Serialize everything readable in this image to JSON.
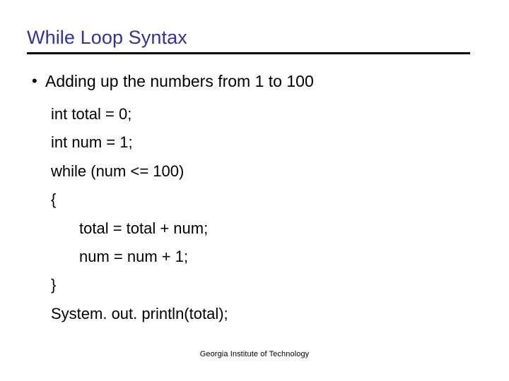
{
  "slide": {
    "title": "While Loop Syntax",
    "title_color": "#333399",
    "rule_color": "#000000",
    "background_color": "#ffffff",
    "bullet": {
      "marker": "•",
      "text": "Adding up the numbers from 1 to 100"
    },
    "code_lines": [
      {
        "text": "int total = 0;",
        "indent": 0
      },
      {
        "text": "int num = 1;",
        "indent": 0
      },
      {
        "text": "while (num <= 100)",
        "indent": 0
      },
      {
        "text": "{",
        "indent": 0
      },
      {
        "text": "total = total + num;",
        "indent": 1
      },
      {
        "text": "num = num + 1;",
        "indent": 1
      },
      {
        "text": "}",
        "indent": 0
      },
      {
        "text": "System. out. println(total);",
        "indent": 0
      }
    ],
    "footer": "Georgia Institute of Technology"
  }
}
